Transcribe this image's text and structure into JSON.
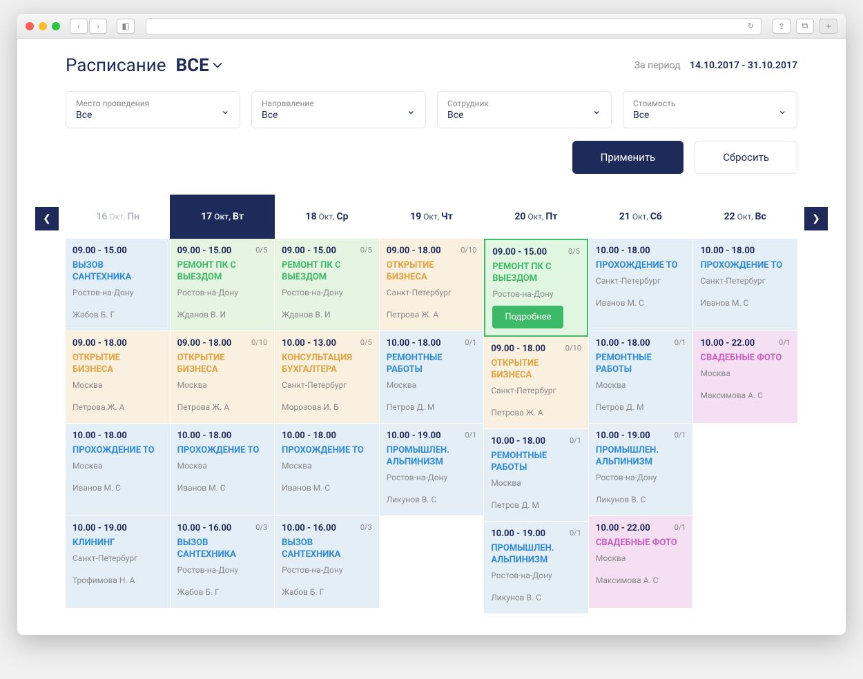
{
  "header": {
    "title": "Расписание",
    "scope": "ВСЕ",
    "period_label": "За период",
    "period_value": "14.10.2017 - 31.10.2017"
  },
  "filters": [
    {
      "label": "Место проведения",
      "value": "Все"
    },
    {
      "label": "Направление",
      "value": "Все"
    },
    {
      "label": "Сотрудник",
      "value": "Все"
    },
    {
      "label": "Стоимость",
      "value": "Все"
    }
  ],
  "actions": {
    "apply": "Применить",
    "reset": "Сбросить"
  },
  "more_label": "Подробнее",
  "days": [
    {
      "num": "16",
      "month": "Окт,",
      "dow": "Пн",
      "muted": true,
      "cards": [
        {
          "time": "09.00 - 15.00",
          "count": "",
          "name": "ВЫЗОВ САНТЕХНИКА",
          "city": "Ростов-на-Дону",
          "person": "Жабов Б. Г",
          "color": "blue"
        },
        {
          "time": "09.00 - 18.00",
          "count": "",
          "name": "ОТКРЫТИЕ БИЗНЕСА",
          "city": "Москва",
          "person": "Петрова Ж. А",
          "color": "orange"
        },
        {
          "time": "10.00 - 18.00",
          "count": "",
          "name": "ПРОХОЖДЕНИЕ ТО",
          "city": "Москва",
          "person": "Иванов М. С",
          "color": "blue"
        },
        {
          "time": "10.00 - 19.00",
          "count": "",
          "name": "КЛИНИНГ",
          "city": "Санкт-Петербург",
          "person": "Трофимова Н. А",
          "color": "blue"
        }
      ]
    },
    {
      "num": "17",
      "month": "Окт,",
      "dow": "Вт",
      "active": true,
      "cards": [
        {
          "time": "09.00 - 15.00",
          "count": "0/5",
          "name": "РЕМОНТ ПК С ВЫЕЗДОМ",
          "city": "Ростов-на-Дону",
          "person": "Жданов В. И",
          "color": "green"
        },
        {
          "time": "09.00 - 18.00",
          "count": "0/10",
          "name": "ОТКРЫТИЕ БИЗНЕСА",
          "city": "Москва",
          "person": "Петрова Ж. А",
          "color": "orange"
        },
        {
          "time": "10.00 - 18.00",
          "count": "",
          "name": "ПРОХОЖДЕНИЕ ТО",
          "city": "Москва",
          "person": "Иванов М. С",
          "color": "blue"
        },
        {
          "time": "10.00 - 16.00",
          "count": "0/3",
          "name": "ВЫЗОВ САНТЕХНИКА",
          "city": "Ростов-на-Дону",
          "person": "Жабов Б. Г",
          "color": "blue"
        }
      ]
    },
    {
      "num": "18",
      "month": "Окт,",
      "dow": "Ср",
      "cards": [
        {
          "time": "09.00 - 15.00",
          "count": "0/5",
          "name": "РЕМОНТ ПК С ВЫЕЗДОМ",
          "city": "Ростов-на-Дону",
          "person": "Жданов В. И",
          "color": "green"
        },
        {
          "time": "10.00 - 13.00",
          "count": "0/5",
          "name": "КОНСУЛЬТАЦИЯ БУХГАЛТЕРА",
          "city": "Санкт-Петербург",
          "person": "Морозова И. Б",
          "color": "orange"
        },
        {
          "time": "10.00 - 18.00",
          "count": "",
          "name": "ПРОХОЖДЕНИЕ ТО",
          "city": "Москва",
          "person": "Иванов М. С",
          "color": "blue"
        },
        {
          "time": "10.00 - 16.00",
          "count": "0/3",
          "name": "ВЫЗОВ САНТЕХНИКА",
          "city": "Ростов-на-Дону",
          "person": "Жабов Б. Г",
          "color": "blue"
        }
      ]
    },
    {
      "num": "19",
      "month": "Окт,",
      "dow": "Чт",
      "cards": [
        {
          "time": "09.00 - 18.00",
          "count": "0/10",
          "name": "ОТКРЫТИЕ БИЗНЕСА",
          "city": "Санкт-Петербург",
          "person": "Петрова Ж. А",
          "color": "orange"
        },
        {
          "time": "10.00 - 18.00",
          "count": "0/1",
          "name": "РЕМОНТНЫЕ РАБОТЫ",
          "city": "Москва",
          "person": "Петров Д. М",
          "color": "blue"
        },
        {
          "time": "10.00 - 19.00",
          "count": "0/1",
          "name": "ПРОМЫШЛЕН. АЛЬПИНИЗМ",
          "city": "Ростов-на-Дону",
          "person": "Ликунов В. С",
          "color": "blue"
        }
      ]
    },
    {
      "num": "20",
      "month": "Окт,",
      "dow": "Пт",
      "cards": [
        {
          "time": "09.00 - 15.00",
          "count": "0/5",
          "name": "РЕМОНТ ПК С ВЫЕЗДОМ",
          "city": "Ростов-на-Дону",
          "person": "",
          "color": "highlight",
          "more": true
        },
        {
          "time": "09.00 - 18.00",
          "count": "0/10",
          "name": "ОТКРЫТИЕ БИЗНЕСА",
          "city": "Санкт-Петербург",
          "person": "Петрова Ж. А",
          "color": "orange"
        },
        {
          "time": "10.00 - 18.00",
          "count": "0/1",
          "name": "РЕМОНТНЫЕ РАБОТЫ",
          "city": "Москва",
          "person": "Петров Д. М",
          "color": "blue"
        },
        {
          "time": "10.00 - 19.00",
          "count": "0/1",
          "name": "ПРОМЫШЛЕН. АЛЬПИНИЗМ",
          "city": "Ростов-на-Дону",
          "person": "Ликунов В. С",
          "color": "blue"
        }
      ]
    },
    {
      "num": "21",
      "month": "Окт,",
      "dow": "Сб",
      "cards": [
        {
          "time": "10.00 - 18.00",
          "count": "",
          "name": "ПРОХОЖДЕНИЕ ТО",
          "city": "Санкт-Петербург",
          "person": "Иванов М. С",
          "color": "blue"
        },
        {
          "time": "10.00 - 18.00",
          "count": "0/1",
          "name": "РЕМОНТНЫЕ РАБОТЫ",
          "city": "Москва",
          "person": "Петров Д. М",
          "color": "blue"
        },
        {
          "time": "10.00 - 19.00",
          "count": "0/1",
          "name": "ПРОМЫШЛЕН. АЛЬПИНИЗМ",
          "city": "Ростов-на-Дону",
          "person": "Ликунов В. С",
          "color": "blue"
        },
        {
          "time": "10.00 - 22.00",
          "count": "0/1",
          "name": "СВАДЕБНЫЕ ФОТО",
          "city": "Москва",
          "person": "Максимова А. С",
          "color": "pink"
        }
      ]
    },
    {
      "num": "22",
      "month": "Окт,",
      "dow": "Вс",
      "cards": [
        {
          "time": "10.00 - 18.00",
          "count": "",
          "name": "ПРОХОЖДЕНИЕ ТО",
          "city": "Санкт-Петербург",
          "person": "Иванов М. С",
          "color": "blue"
        },
        {
          "time": "10.00 - 22.00",
          "count": "0/1",
          "name": "СВАДЕБНЫЕ ФОТО",
          "city": "Москва",
          "person": "Максимова А. С",
          "color": "pink"
        }
      ]
    }
  ]
}
